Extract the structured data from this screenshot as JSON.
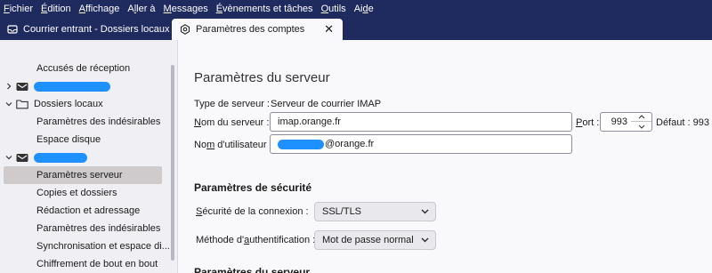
{
  "menubar": {
    "items": [
      {
        "pre": "",
        "u": "F",
        "post": "ichier"
      },
      {
        "pre": "",
        "u": "É",
        "post": "dition"
      },
      {
        "pre": "",
        "u": "A",
        "post": "ffichage"
      },
      {
        "pre": "A",
        "u": "l",
        "post": "ler à"
      },
      {
        "pre": "",
        "u": "M",
        "post": "essages"
      },
      {
        "pre": "",
        "u": "É",
        "post": "vènements et tâches"
      },
      {
        "pre": "",
        "u": "O",
        "post": "utils"
      },
      {
        "pre": "Ai",
        "u": "d",
        "post": "e"
      }
    ]
  },
  "tabs": {
    "inactive_label": "Courrier entrant - Dossiers locaux",
    "active_label": "Paramètres des comptes",
    "close_glyph": "✕"
  },
  "sidebar": {
    "items": [
      {
        "label": "Accusés de réception",
        "type": "sub"
      },
      {
        "label": "",
        "type": "account",
        "expanded": false
      },
      {
        "label": "Dossiers locaux",
        "type": "folder",
        "expanded": true
      },
      {
        "label": "Paramètres des indésirables",
        "type": "sub"
      },
      {
        "label": "Espace disque",
        "type": "sub"
      },
      {
        "label": "",
        "type": "account",
        "expanded": true
      },
      {
        "label": "Paramètres serveur",
        "type": "sub",
        "selected": true
      },
      {
        "label": "Copies et dossiers",
        "type": "sub"
      },
      {
        "label": "Rédaction et adressage",
        "type": "sub"
      },
      {
        "label": "Paramètres des indésirables",
        "type": "sub"
      },
      {
        "label": "Synchronisation et espace di...",
        "type": "sub"
      },
      {
        "label": "Chiffrement de bout en bout",
        "type": "sub"
      }
    ]
  },
  "main": {
    "title": "Paramètres du serveur",
    "server_type_label": "Type de serveur :",
    "server_type_value": "Serveur de courrier IMAP",
    "server_name_label": {
      "pre": "",
      "u": "N",
      "post": "om du serveur :"
    },
    "server_name_value": "imap.orange.fr",
    "port_label": {
      "pre": "",
      "u": "P",
      "post": "ort :"
    },
    "port_value": "993",
    "default_label": "Défaut : 993",
    "username_label": {
      "pre": "No",
      "u": "m",
      "post": " d'utilisateur :"
    },
    "username_suffix": "@orange.fr",
    "security_heading": "Paramètres de sécurité",
    "connection_security_label": {
      "pre": "",
      "u": "S",
      "post": "écurité de la connexion :"
    },
    "connection_security_value": "SSL/TLS",
    "auth_method_label": {
      "pre": "Méthode d'",
      "u": "a",
      "post": "uthentification :"
    },
    "auth_method_value": "Mot de passe normal",
    "next_heading": "Paramètres du serveur"
  },
  "colors": {
    "menubar_bg": "#1f2b5f",
    "redaction": "#1e90ff",
    "selected_row": "#cfcbcc"
  }
}
